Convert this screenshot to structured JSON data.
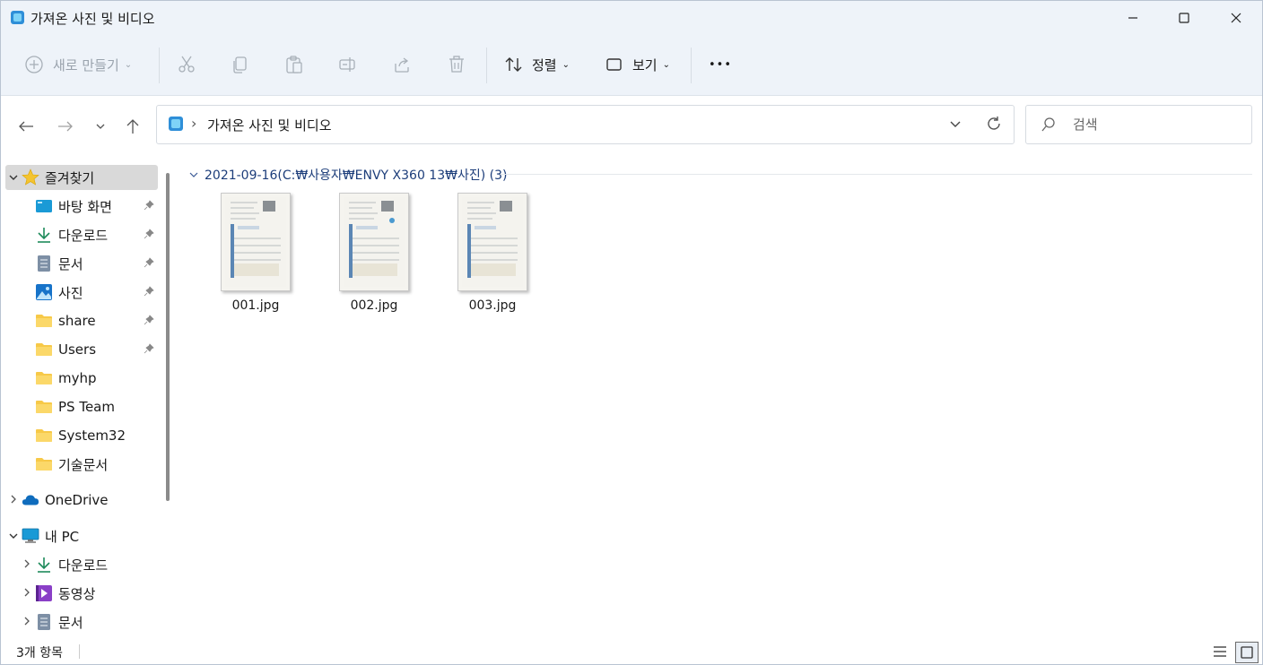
{
  "window": {
    "title": "가져온 사진 및 비디오"
  },
  "commandbar": {
    "new_label": "새로 만들기",
    "sort_label": "정렬",
    "view_label": "보기",
    "more_label": "•••"
  },
  "address": {
    "path_segment": "가져온 사진 및 비디오",
    "separator": "›"
  },
  "search": {
    "placeholder": "검색"
  },
  "sidebar": {
    "favorites_label": "즐겨찾기",
    "items": [
      {
        "label": "바탕 화면",
        "icon": "desktop-icon",
        "pinned": true
      },
      {
        "label": "다운로드",
        "icon": "download-icon",
        "pinned": true
      },
      {
        "label": "문서",
        "icon": "document-icon",
        "pinned": true
      },
      {
        "label": "사진",
        "icon": "pictures-icon",
        "pinned": true
      },
      {
        "label": "share",
        "icon": "folder-icon",
        "pinned": true
      },
      {
        "label": "Users",
        "icon": "folder-icon",
        "pinned": true
      },
      {
        "label": "myhp",
        "icon": "folder-icon",
        "pinned": false
      },
      {
        "label": "PS Team",
        "icon": "folder-icon",
        "pinned": false
      },
      {
        "label": "System32",
        "icon": "folder-icon",
        "pinned": false
      },
      {
        "label": "기술문서",
        "icon": "folder-icon",
        "pinned": false
      }
    ],
    "onedrive_label": "OneDrive",
    "pc_label": "내 PC",
    "pc_items": [
      {
        "label": "다운로드",
        "icon": "download-icon"
      },
      {
        "label": "동영상",
        "icon": "video-icon"
      },
      {
        "label": "문서",
        "icon": "document-icon"
      }
    ]
  },
  "content": {
    "group_header": "2021-09-16(C:₩사용자₩ENVY X360 13₩사진) (3)",
    "files": [
      {
        "name": "001.jpg"
      },
      {
        "name": "002.jpg"
      },
      {
        "name": "003.jpg"
      }
    ]
  },
  "status": {
    "item_count": "3개 항목"
  },
  "colors": {
    "chrome_bg": "#eef3f9",
    "accent": "#1c3d7a",
    "selection": "#d9d9d9"
  }
}
